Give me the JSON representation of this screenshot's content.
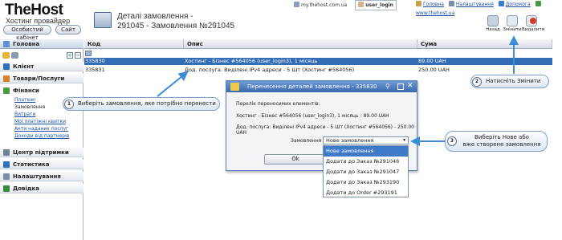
{
  "brand": {
    "logo": "TheHost",
    "tagline": "Хостинг провайдер"
  },
  "header_buttons": {
    "cabinet": "Особистий кабінет",
    "site": "Сайт"
  },
  "page_title": {
    "line1": "Деталі замовлення -",
    "line2": "291045 - Замовлення №291045"
  },
  "top_bar": {
    "url": "my.thehost.com.ua",
    "user": "user_login",
    "home": "Головна",
    "settings": "Налаштування",
    "help": "Допомога",
    "site": "www.thehost.ua"
  },
  "toolbar": {
    "back": "Назад",
    "edit": "Змінити",
    "delete": "Видалити"
  },
  "sidebar": {
    "header": "Головна",
    "items": [
      {
        "label": "Клієнт"
      },
      {
        "label": "Товари/Послуги"
      },
      {
        "label": "Фінанси"
      }
    ],
    "finance_sub": [
      "Платежі",
      "Замовлення",
      "Витрати",
      "Мої платіжні квитки",
      "Акти наданих послуг",
      "Доходи від партнерів"
    ],
    "bottom_items": [
      {
        "label": "Центр підтримки"
      },
      {
        "label": "Статистика"
      },
      {
        "label": "Налаштування"
      },
      {
        "label": "Довідка"
      }
    ]
  },
  "table": {
    "columns": [
      "Код",
      "Опис",
      "Сума"
    ],
    "rows": [
      {
        "code": "335830",
        "desc": "Хостинг - Бізнес #564056 (user_login3), 1 місяць",
        "sum": "89.00 UAH"
      },
      {
        "code": "335831",
        "desc": "Дод. послуга: Виділені IPv4 адреси - 5 Шт (Хостинг #564056)",
        "sum": "250.00 UAH"
      }
    ]
  },
  "dialog": {
    "title": "Перенесення деталей замовлення - 335830",
    "intro": "Перелік переносимих елементів:",
    "item1": "Хостинг - Бізнес #564056 (user_login3), 1 місяць - 89.00 UAH",
    "item2": "Дод. послуга: Виділені IPv4 адреси - 5 Шт (Хостинг #564056) - 250.00 UAH",
    "field_label": "Замовлення",
    "selected": "Нове замовлення",
    "options": [
      "Нове замовлення",
      "Додати до Заказ №291046",
      "Додати до Заказ №291047",
      "Додати до Заказ №293190",
      "Додати до Order #293191"
    ],
    "ok": "Ok"
  },
  "callouts": [
    {
      "num": "1",
      "text": "Виберіть замовлення, яке потрібно перенести"
    },
    {
      "num": "2",
      "text": "Натисніть Змінити"
    },
    {
      "num": "3",
      "line1": "Виберіть Нове або",
      "line2": "вже створене замовлення"
    }
  ]
}
